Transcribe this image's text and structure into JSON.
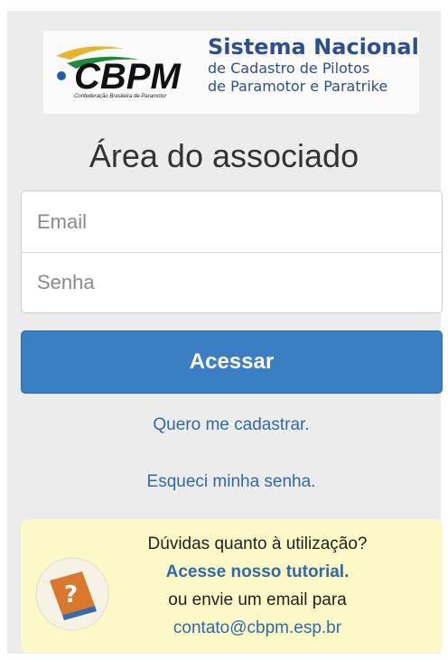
{
  "logo": {
    "mark": "CBPM",
    "org_text": "Confederação Brasileira de Paramotor",
    "title_line1": "Sistema Nacional",
    "title_line2": "de Cadastro de Pilotos",
    "title_line3": "de Paramotor e Paratrike"
  },
  "heading": "Área do associado",
  "form": {
    "email_placeholder": "Email",
    "password_placeholder": "Senha"
  },
  "buttons": {
    "login_label": "Acessar"
  },
  "links": {
    "register": "Quero me cadastrar.",
    "forgot_password": "Esqueci minha senha."
  },
  "help": {
    "icon": "question-book-icon",
    "line1": "Dúvidas quanto à utilização?",
    "tutorial_link": "Acesse nosso tutorial.",
    "line3": "ou envie um email para",
    "email": "contato@cbpm.esp.br"
  },
  "colors": {
    "accent": "#3a7ec3",
    "link": "#2f6aa6",
    "help_bg": "#fcf8c7",
    "panel_bg": "#ececec"
  }
}
